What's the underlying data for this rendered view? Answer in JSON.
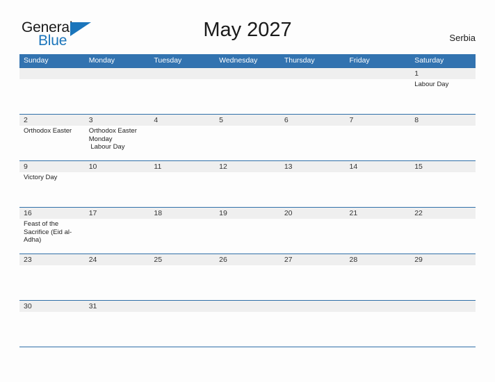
{
  "brand": {
    "word_one": "General",
    "word_two": "Blue",
    "accent_color": "#1b75bb",
    "triangle_icon": "triangle-icon"
  },
  "header": {
    "title": "May 2027",
    "country": "Serbia"
  },
  "calendar": {
    "header_bg": "#3273b0",
    "band_bg": "#efefef",
    "rule_color": "#2f6fa8",
    "day_names": [
      "Sunday",
      "Monday",
      "Tuesday",
      "Wednesday",
      "Thursday",
      "Friday",
      "Saturday"
    ],
    "weeks": [
      [
        {
          "num": "",
          "events": []
        },
        {
          "num": "",
          "events": []
        },
        {
          "num": "",
          "events": []
        },
        {
          "num": "",
          "events": []
        },
        {
          "num": "",
          "events": []
        },
        {
          "num": "",
          "events": []
        },
        {
          "num": "1",
          "events": [
            "Labour Day"
          ]
        }
      ],
      [
        {
          "num": "2",
          "events": [
            "Orthodox Easter"
          ]
        },
        {
          "num": "3",
          "events": [
            "Orthodox Easter Monday\n Labour Day"
          ]
        },
        {
          "num": "4",
          "events": []
        },
        {
          "num": "5",
          "events": []
        },
        {
          "num": "6",
          "events": []
        },
        {
          "num": "7",
          "events": []
        },
        {
          "num": "8",
          "events": []
        }
      ],
      [
        {
          "num": "9",
          "events": [
            "Victory Day"
          ]
        },
        {
          "num": "10",
          "events": []
        },
        {
          "num": "11",
          "events": []
        },
        {
          "num": "12",
          "events": []
        },
        {
          "num": "13",
          "events": []
        },
        {
          "num": "14",
          "events": []
        },
        {
          "num": "15",
          "events": []
        }
      ],
      [
        {
          "num": "16",
          "events": [
            "Feast of the Sacrifice (Eid al-Adha)"
          ]
        },
        {
          "num": "17",
          "events": []
        },
        {
          "num": "18",
          "events": []
        },
        {
          "num": "19",
          "events": []
        },
        {
          "num": "20",
          "events": []
        },
        {
          "num": "21",
          "events": []
        },
        {
          "num": "22",
          "events": []
        }
      ],
      [
        {
          "num": "23",
          "events": []
        },
        {
          "num": "24",
          "events": []
        },
        {
          "num": "25",
          "events": []
        },
        {
          "num": "26",
          "events": []
        },
        {
          "num": "27",
          "events": []
        },
        {
          "num": "28",
          "events": []
        },
        {
          "num": "29",
          "events": []
        }
      ],
      [
        {
          "num": "30",
          "events": []
        },
        {
          "num": "31",
          "events": []
        },
        {
          "num": "",
          "events": []
        },
        {
          "num": "",
          "events": []
        },
        {
          "num": "",
          "events": []
        },
        {
          "num": "",
          "events": []
        },
        {
          "num": "",
          "events": []
        }
      ]
    ]
  }
}
